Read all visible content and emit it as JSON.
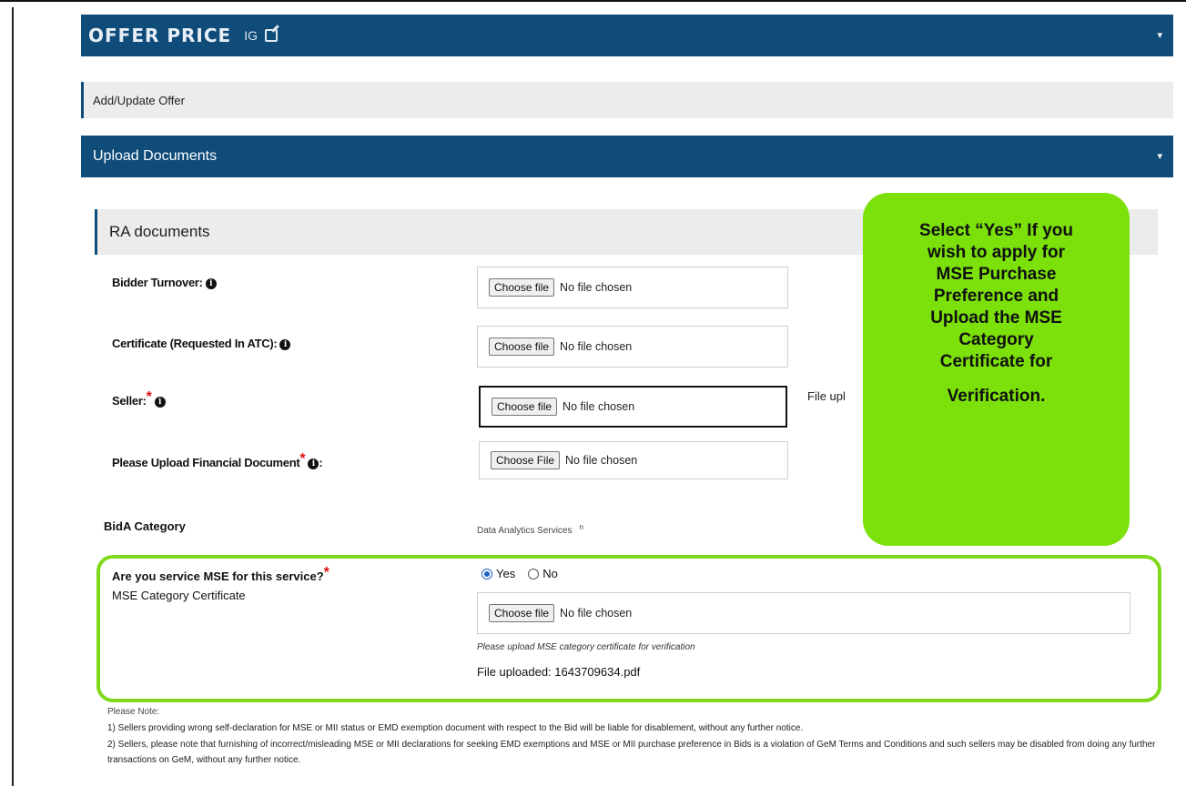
{
  "header": {
    "offer_title": "OFFER PRICE",
    "offer_suffix": "IG",
    "add_update": "Add/Update Offer",
    "upload_documents": "Upload Documents",
    "caret": "▾"
  },
  "ra_documents": {
    "title": "RA documents",
    "rows": [
      {
        "label": "Bidder Turnover:",
        "button": "Choose file",
        "status": "No file chosen"
      },
      {
        "label": "Certificate (Requested In ATC):",
        "button": "Choose file",
        "status": "No file chosen"
      },
      {
        "label": "Seller:",
        "button": "Choose file",
        "status": "No file chosen",
        "side_text": "File upl"
      },
      {
        "label": "Please Upload Financial Document",
        "button": "Choose File",
        "status": "No file chosen"
      }
    ]
  },
  "bid_category": {
    "label": "BidA Category",
    "value": "Data Analytics Services",
    "mark": "n"
  },
  "mse": {
    "question": "Are you service MSE for this service?",
    "options": [
      "Yes",
      "No"
    ],
    "selected": "Yes",
    "cert_label": "MSE Category Certificate",
    "button": "Choose file",
    "status": "No file chosen",
    "hint": "Please upload MSE category certificate for verification",
    "uploaded": "File uploaded: 1643709634.pdf"
  },
  "callout": {
    "lines": [
      "Select “Yes” If you",
      "wish to apply for",
      "MSE Purchase",
      "Preference and",
      "Upload the MSE",
      "Category",
      "Certificate for",
      "Verification."
    ]
  },
  "notes": {
    "title": "Please Note:",
    "items": [
      "1) Sellers providing wrong self-declaration for MSE or MII status or EMD exemption document with respect to the Bid will be liable for disablement, without any further notice.",
      "2) Sellers, please note that furnishing of incorrect/misleading MSE or MII declarations for seeking EMD exemptions and MSE or MII purchase preference in Bids is a violation of GeM Terms and Conditions and such sellers may be disabled from doing any further transactions on GeM, without any further notice."
    ]
  },
  "colors": {
    "header_blue": "#0f4c7a",
    "callout_green": "#7ce00a",
    "highlight_green": "#80d81a",
    "required_red": "#e01010"
  }
}
